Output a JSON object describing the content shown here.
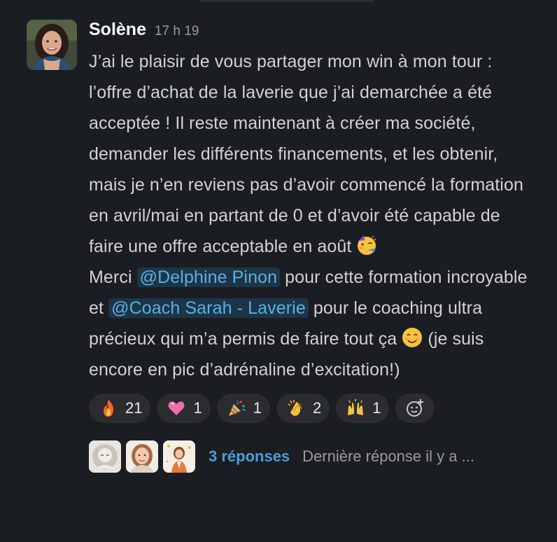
{
  "message": {
    "author": "Solène",
    "time": "17 h 19",
    "text_1": "J’ai le plaisir de vous partager mon win à mon tour : l’offre d’achat de la laverie que j’ai demarchée a été acceptée ! Il reste maintenant à créer ma société, demander les différents financements, et les obtenir, mais je n’en reviens pas d’avoir commencé la formation en avril/mai en partant de 0 et d’avoir été capable de faire une offre acceptable en août",
    "text_2": "Merci",
    "mention_1": "@Delphine Pinon",
    "text_3": "pour cette formation incroyable et",
    "mention_2": "@Coach Sarah - Laverie",
    "text_4": "pour le coaching ultra précieux qui m’a permis de faire tout ça",
    "text_5": "(je suis encore en pic d’adrénaline d’excitation!)",
    "inline_emojis": [
      "partying-face-icon",
      "smiling-face-icon"
    ]
  },
  "reactions": [
    {
      "icon": "fire-icon",
      "count": "21"
    },
    {
      "icon": "pink-heart-icon",
      "count": "1"
    },
    {
      "icon": "party-popper-icon",
      "count": "1"
    },
    {
      "icon": "clapping-hands-icon",
      "count": "2"
    },
    {
      "icon": "raising-hands-icon",
      "count": "1"
    },
    {
      "icon": "add-reaction-icon",
      "count": ""
    }
  ],
  "thread": {
    "reply_count": "3 réponses",
    "last_reply": "Dernière réponse il y a ..."
  },
  "colors": {
    "background": "#1a1d21",
    "text": "#d1d2d3",
    "mention_bg": "#1d3546",
    "mention_text": "#58b0e6",
    "link": "#4a9ed6",
    "reaction_bg": "#2b2c30"
  }
}
